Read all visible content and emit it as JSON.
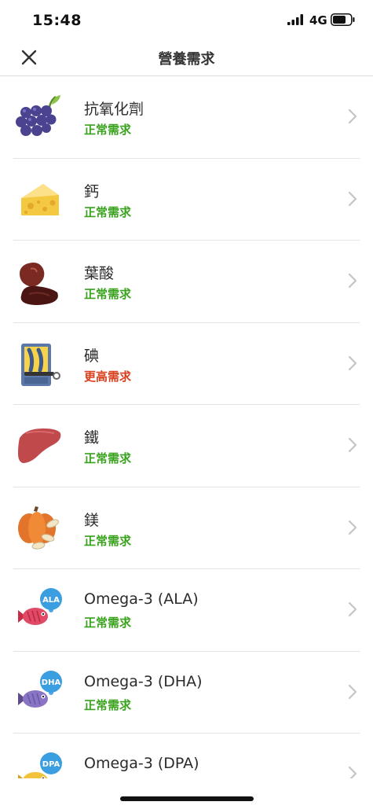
{
  "status_bar": {
    "time": "15:48",
    "network": "4G"
  },
  "nav": {
    "title": "營養需求"
  },
  "nutrients": [
    {
      "name": "抗氧化劑",
      "status": "正常需求",
      "status_color": "#3aa21e",
      "icon": "grapes-icon"
    },
    {
      "name": "鈣",
      "status": "正常需求",
      "status_color": "#3aa21e",
      "icon": "cheese-icon"
    },
    {
      "name": "葉酸",
      "status": "正常需求",
      "status_color": "#3aa21e",
      "icon": "bean-icon"
    },
    {
      "name": "碘",
      "status": "更高需求",
      "status_color": "#d9401f",
      "icon": "sardine-can-icon"
    },
    {
      "name": "鐵",
      "status": "正常需求",
      "status_color": "#3aa21e",
      "icon": "liver-icon"
    },
    {
      "name": "鎂",
      "status": "正常需求",
      "status_color": "#3aa21e",
      "icon": "pumpkin-seeds-icon"
    },
    {
      "name": "Omega-3 (ALA)",
      "status": "正常需求",
      "status_color": "#3aa21e",
      "icon": "fish-ala-icon",
      "badge": "ALA"
    },
    {
      "name": "Omega-3 (DHA)",
      "status": "正常需求",
      "status_color": "#3aa21e",
      "icon": "fish-dha-icon",
      "badge": "DHA"
    },
    {
      "name": "Omega-3 (DPA)",
      "status": "",
      "status_color": "#3aa21e",
      "icon": "fish-dpa-icon",
      "badge": "DPA"
    }
  ]
}
